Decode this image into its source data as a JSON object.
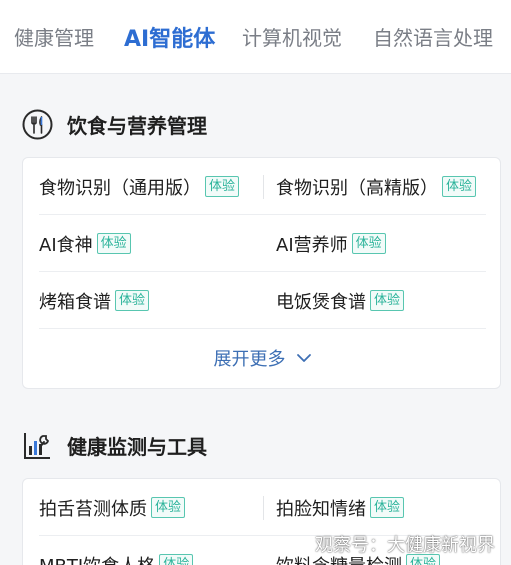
{
  "tabs": [
    {
      "label": "健康管理",
      "active": false
    },
    {
      "label": "AI智能体",
      "active": true
    },
    {
      "label": "计算机视觉",
      "active": false
    },
    {
      "label": "自然语言处理",
      "active": false
    }
  ],
  "sections": [
    {
      "title": "饮食与营养管理",
      "icon": "fork-knife-icon",
      "items": [
        {
          "label": "食物识别（通用版）",
          "badge": "体验"
        },
        {
          "label": "食物识别（高精版）",
          "badge": "体验"
        },
        {
          "label": "AI食神",
          "badge": "体验"
        },
        {
          "label": "AI营养师",
          "badge": "体验"
        },
        {
          "label": "烤箱食谱",
          "badge": "体验"
        },
        {
          "label": "电饭煲食谱",
          "badge": "体验"
        }
      ],
      "expand_label": "展开更多"
    },
    {
      "title": "健康监测与工具",
      "icon": "chart-wrench-icon",
      "items": [
        {
          "label": "拍舌苔测体质",
          "badge": "体验"
        },
        {
          "label": "拍脸知情绪",
          "badge": "体验"
        },
        {
          "label": "MBTI饮食人格",
          "badge": "体验"
        },
        {
          "label": "饮料含糖量检测",
          "badge": "体验"
        }
      ]
    }
  ],
  "watermark": "观察号：大健康新视界",
  "colors": {
    "accent": "#2d6dd2",
    "badge": "#2bb39a",
    "link": "#3d6fb4"
  }
}
